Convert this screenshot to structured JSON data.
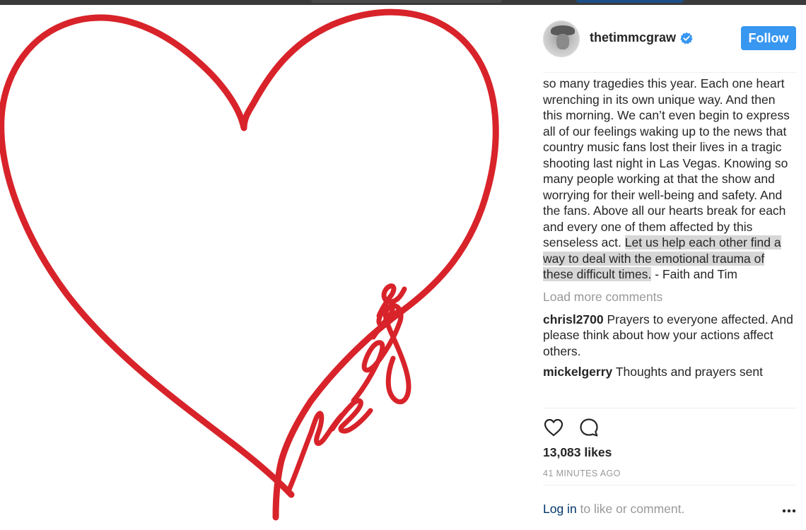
{
  "post": {
    "image_alt": "Red heart outline with the word vegas written in script",
    "image_word": "vegas",
    "heart_color": "#d8232a"
  },
  "header": {
    "username": "thetimmcgraw",
    "verified_icon": "verified-badge-icon",
    "follow_label": "Follow"
  },
  "caption": {
    "lines_before": "so many tragedies this year. Each one heart wrenching in its own unique way. And then this morning. We can’t even begin to express all of our feelings waking up to the news that country music fans lost their lives in a tragic shooting last night in Las Vegas. Knowing so many people working at that the show and worrying for their well-being and safety. And the fans. Above all our hearts break for each and every one of them affected by this senseless act.",
    "highlighted": "Let us help each other find a way to deal with the emotional trauma of these difficult times.",
    "after": " - Faith and Tim"
  },
  "load_more_label": "Load more comments",
  "comments": [
    {
      "user": "chrisl2700",
      "text": "Prayers to everyone affected. And please think about how your actions affect others."
    },
    {
      "user": "mickelgerry",
      "text": "Thoughts and prayers sent"
    }
  ],
  "actions": {
    "like_icon": "heart-icon",
    "comment_icon": "comment-icon"
  },
  "likes_text": "13,083 likes",
  "timestamp": "41 MINUTES AGO",
  "footer": {
    "login_link": "Log in",
    "login_rest": " to like or comment.",
    "more_icon": "more-options-icon"
  },
  "colors": {
    "accent": "#3897f0",
    "heart": "#d8232a",
    "muted": "#999999",
    "highlight": "#d7d7d7"
  }
}
